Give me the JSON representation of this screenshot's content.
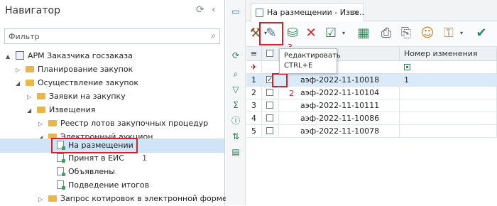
{
  "navigator": {
    "title": "Навигатор",
    "filter_placeholder": "Фильтр",
    "tree": [
      {
        "label": "АРМ Заказчика госзаказа",
        "kind": "app",
        "expander": "▲"
      },
      {
        "label": "Планирование закупок",
        "kind": "folder",
        "expander": "▷"
      },
      {
        "label": "Осуществление закупок",
        "kind": "folder",
        "expander": "◢"
      },
      {
        "label": "Заявки на закупку",
        "kind": "folder",
        "expander": "▷"
      },
      {
        "label": "Извещения",
        "kind": "folder",
        "expander": "◢"
      },
      {
        "label": "Реестр лотов закупочных процедур",
        "kind": "folder",
        "expander": "▷"
      },
      {
        "label": "Электронный аукцион",
        "kind": "folder",
        "expander": "◢"
      },
      {
        "label": "На размещении",
        "kind": "doc",
        "expander": ""
      },
      {
        "label": "Принят в ЕИС",
        "kind": "doc",
        "expander": ""
      },
      {
        "label": "Объявлены",
        "kind": "doc",
        "expander": ""
      },
      {
        "label": "Подведение итогов",
        "kind": "doc",
        "expander": ""
      },
      {
        "label": "Запрос котировок в электронной форме",
        "kind": "folder",
        "expander": "▷"
      }
    ],
    "refresh_icon": "refresh-icon",
    "collapse_icon": "chevron-left-icon"
  },
  "tab": {
    "label": "На размещении - Изве...",
    "close": "×"
  },
  "toolbar": {
    "tooltip_line1": "Редактировать",
    "tooltip_line2": "CTRL+E"
  },
  "grid": {
    "col_change_no": "Номер изменения",
    "rows": [
      {
        "n": "1",
        "checked": true,
        "num": "аэф-2022-11-10018",
        "change": "1"
      },
      {
        "n": "2",
        "checked": false,
        "num": "аэф-2022-11-10104",
        "change": ""
      },
      {
        "n": "3",
        "checked": false,
        "num": "аэф-2022-11-10111",
        "change": ""
      },
      {
        "n": "4",
        "checked": false,
        "num": "аэф-2022-11-10086",
        "change": ""
      },
      {
        "n": "5",
        "checked": false,
        "num": "аэф-2022-11-10078",
        "change": ""
      }
    ]
  },
  "annotations": {
    "one": "1",
    "two": "2",
    "three": "3"
  },
  "colors": {
    "accent_red": "#d2232a",
    "selection": "#cfe4f7",
    "folder": "#e9b649"
  }
}
